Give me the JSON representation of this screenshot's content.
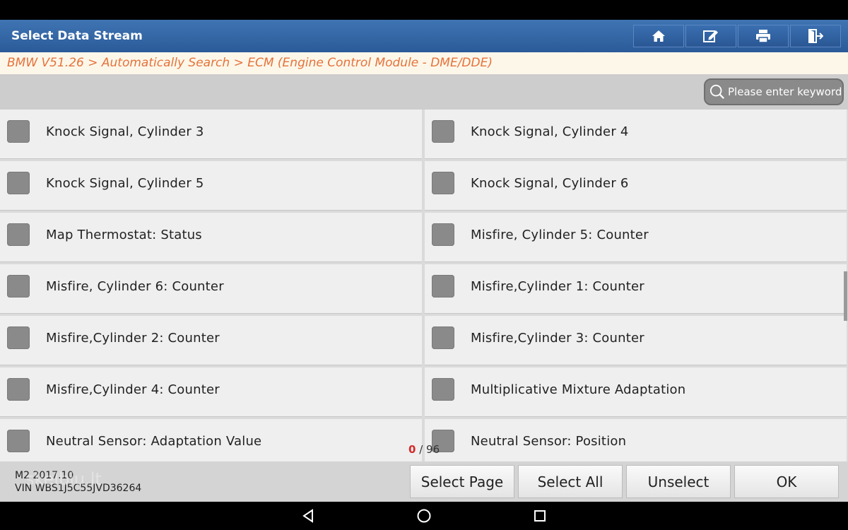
{
  "header": {
    "title": "Select Data Stream"
  },
  "toolbar": [
    {
      "name": "home-button",
      "icon": "home-icon"
    },
    {
      "name": "edit-button",
      "icon": "edit-icon"
    },
    {
      "name": "print-button",
      "icon": "printer-icon"
    },
    {
      "name": "exit-button",
      "icon": "exit-icon"
    }
  ],
  "breadcrumb": "BMW V51.26 > Automatically Search > ECM (Engine Control Module - DME/DDE)",
  "search": {
    "placeholder": "Please enter keyword",
    "value": ""
  },
  "items": [
    {
      "label": "Knock Signal, Cylinder 3",
      "checked": false
    },
    {
      "label": "Knock Signal, Cylinder 4",
      "checked": false
    },
    {
      "label": "Knock Signal, Cylinder 5",
      "checked": false
    },
    {
      "label": "Knock Signal, Cylinder 6",
      "checked": false
    },
    {
      "label": "Map Thermostat: Status",
      "checked": false
    },
    {
      "label": "Misfire, Cylinder 5: Counter",
      "checked": false
    },
    {
      "label": "Misfire, Cylinder 6: Counter",
      "checked": false
    },
    {
      "label": "Misfire,Cylinder 1: Counter",
      "checked": false
    },
    {
      "label": "Misfire,Cylinder 2: Counter",
      "checked": false
    },
    {
      "label": "Misfire,Cylinder 3: Counter",
      "checked": false
    },
    {
      "label": "Misfire,Cylinder 4: Counter",
      "checked": false
    },
    {
      "label": "Multiplicative Mixture Adaptation",
      "checked": false
    },
    {
      "label": "Neutral Sensor: Adaptation Value",
      "checked": false
    },
    {
      "label": "Neutral Sensor: Position",
      "checked": false
    }
  ],
  "counter": {
    "selected": "0",
    "separator": " / ",
    "total": "96"
  },
  "vehicle": {
    "model": "M2 2017.10",
    "vin": "VIN WBS1J5C55JVD36264"
  },
  "watermark": "skelbiu.lt",
  "buttons": {
    "select_page": "Select Page",
    "select_all": "Select All",
    "unselect": "Unselect",
    "ok": "OK"
  },
  "colors": {
    "header": "#2b5b99",
    "breadcrumb_text": "#e5723a",
    "counter_selected": "#d42a2a"
  }
}
